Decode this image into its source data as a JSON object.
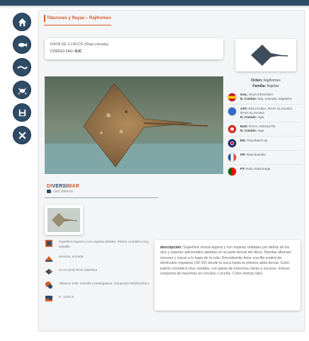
{
  "breadcrumb": "Tiburones y Rayas – Rajiformes",
  "species": {
    "name_prefix": "RAYA DE CLAVOS ",
    "scientific": "(Raja clavata)",
    "code_label": "CÓDIGO FAO: ",
    "code": "RJC"
  },
  "photo": {
    "logo_a": "DI",
    "logo_b": "VERSI",
    "logo_c": "MAR",
    "credit": "Unit Valence"
  },
  "taxonomy": {
    "order_label": "Orden: ",
    "order": "Rajiformes",
    "family_label": "Familia: ",
    "family": "Rajidae"
  },
  "common_names": [
    {
      "flag": "spain",
      "lang": "GAL: ",
      "name": "RAIA CRAVUDA",
      "sub_label": "N. Común: ",
      "sub": "raia, cravuda, raspiteira"
    },
    {
      "flag": "es-ast",
      "lang": "AST: ",
      "name": "ESCAYUDA, RAYA CLAVUDA, RAYA CLAVUDA",
      "sub_label": "N. Común: ",
      "sub": "raya"
    },
    {
      "flag": "basque",
      "lang": "EUS: ",
      "name": "RAYA, AGUILOTE",
      "sub_label": "N. Común: ",
      "sub": "raya"
    },
    {
      "flag": "uk",
      "lang": "EN: ",
      "name": "Thornback ray",
      "sub_label": "",
      "sub": ""
    },
    {
      "flag": "france",
      "lang": "FR: ",
      "name": "Raie bouclée",
      "sub_label": "",
      "sub": ""
    },
    {
      "flag": "portugal",
      "lang": "PT: ",
      "name": "Raia, Raia-lenga",
      "sub_label": "",
      "sub": ""
    }
  ],
  "info": [
    {
      "icon": "morphology-icon",
      "text": "Superficie áspera y con espinas aletales. Patrón cromático muy variable."
    },
    {
      "icon": "habitat-icon",
      "text": "arenoso, enrrada"
    },
    {
      "icon": "size-icon",
      "text": "ml cm (Ext)   DOG 226/2012"
    },
    {
      "icon": "distribution-icon",
      "text": "Atlántico Este: Islandia a Madagascar, incluyendo Mediterráneo."
    },
    {
      "icon": "depth-icon",
      "text": "5 - 1020 m"
    }
  ],
  "description": {
    "label": "descripción: ",
    "text": "Superficie dorsal áspera y con espinas orbitales por detrás de los ojos y espinas adicionales aisladas en la parte dorsal del disco. Bandas alternas oscuras y claras a lo largo de la cola. Dorsalmente tiene una fila central de dentículos regulares (30–50) desde la nuca hasta la primera aleta dorsal. Color: patrón cromático muy variable, con gama de manchas claras y oscuras, incluso conjuntos de manchas en círculos u ocelos. Color ventral claro."
  }
}
